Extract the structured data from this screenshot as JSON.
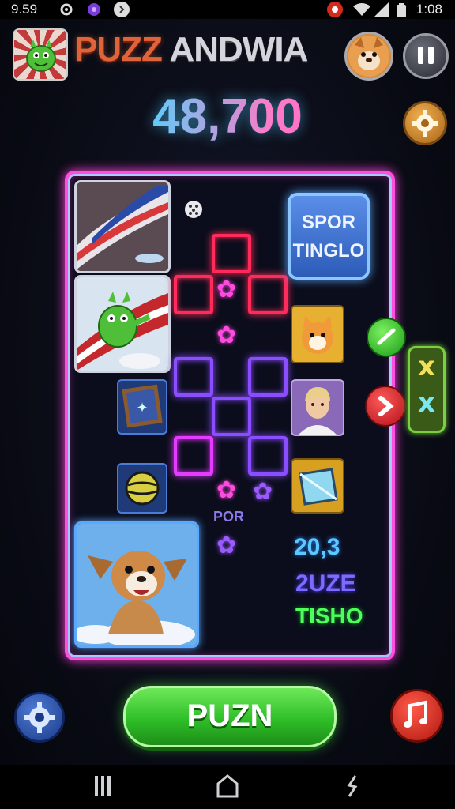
{
  "status_bar": {
    "time": "9.59",
    "clock": "1:08",
    "icons": [
      "gear-icon",
      "flower-icon",
      "chevron-right-icon",
      "alert-icon",
      "wifi-icon",
      "signal-icon",
      "battery-icon"
    ]
  },
  "header": {
    "title_part1": "PUZZ",
    "title_part2": "ANDWIA",
    "score": "48,700"
  },
  "board": {
    "spor_box": {
      "line1": "SPOR",
      "line2": "TINGLO"
    },
    "center_label": "POR",
    "stats": [
      {
        "text": "20,3",
        "color": "#5cc8ff"
      },
      {
        "text": "2UZE",
        "color": "#7a6cff"
      },
      {
        "text": "TISHO",
        "color": "#4cff5a"
      }
    ]
  },
  "side_controls": {
    "check_icon": "check-icon",
    "next_icon": "arrow-right-icon",
    "x_marks": [
      "x",
      "x"
    ]
  },
  "bottom": {
    "play_label": "PUZN",
    "settings_icon": "gear-icon",
    "music_icon": "music-icon"
  },
  "nav": {
    "icons": [
      "recent-apps-icon",
      "home-icon",
      "back-icon"
    ]
  },
  "colors": {
    "board_border": "#ff4fe0",
    "score_gradient_start": "#36c8ff",
    "score_gradient_end": "#ff4fb6",
    "play_button": "#2fbf28"
  }
}
